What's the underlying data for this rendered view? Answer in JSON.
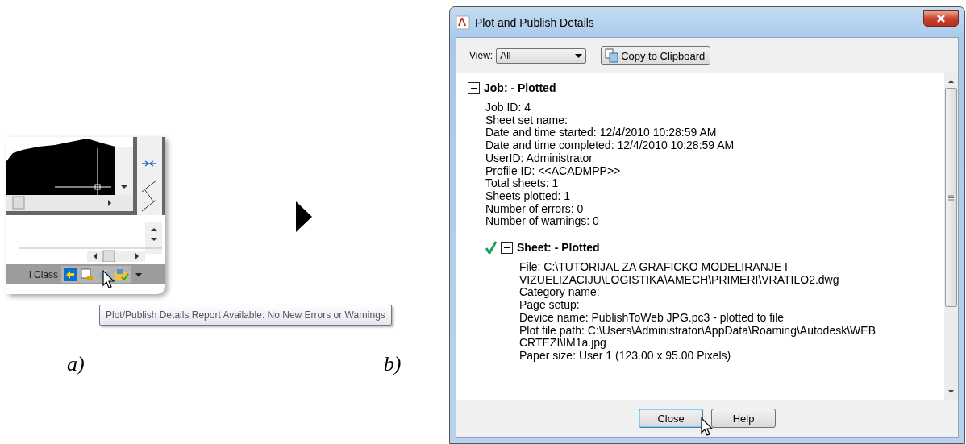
{
  "figure_a": {
    "status_bar": {
      "label": "l Class"
    },
    "tooltip": "Plot/Publish Details Report Available: No New Errors or Warnings",
    "caption": "a)"
  },
  "figure_b": {
    "caption": "b)"
  },
  "dialog": {
    "title": "Plot and Publish Details",
    "view_label": "View:",
    "view_value": "All",
    "copy_button": "Copy to Clipboard",
    "job": {
      "heading": "Job: - Plotted",
      "expanded": true,
      "details": [
        "Job ID: 4",
        "Sheet set name:",
        "Date and time started: 12/4/2010 10:28:59 AM",
        "Date and time completed: 12/4/2010 10:28:59 AM",
        "UserID: Administrator",
        "Profile ID: <<ACADMPP>>",
        "Total sheets: 1",
        "Sheets plotted: 1",
        "Number of errors: 0",
        "Number of warnings: 0"
      ],
      "children": [
        {
          "heading": "Sheet: - Plotted",
          "expanded": true,
          "succeeded": true,
          "details": [
            "File: C:\\TUTORIJAL ZA GRAFICKO MODELIRANJE I VIZUELIZACIJU\\LOGISTIKA\\AMECH\\PRIMERI\\VRATILO2.dwg",
            "Category name:",
            "Page setup:",
            "Device name: PublishToWeb JPG.pc3 - plotted to file",
            "Plot file path: C:\\Users\\Administrator\\AppData\\Roaming\\Autodesk\\WEB CRTEZI\\IM1a.jpg",
            "Paper size: User 1 (123.00 x 95.00 Pixels)"
          ]
        }
      ]
    },
    "buttons": [
      {
        "label": "Close",
        "default": true
      },
      {
        "label": "Help",
        "default": false
      }
    ]
  }
}
